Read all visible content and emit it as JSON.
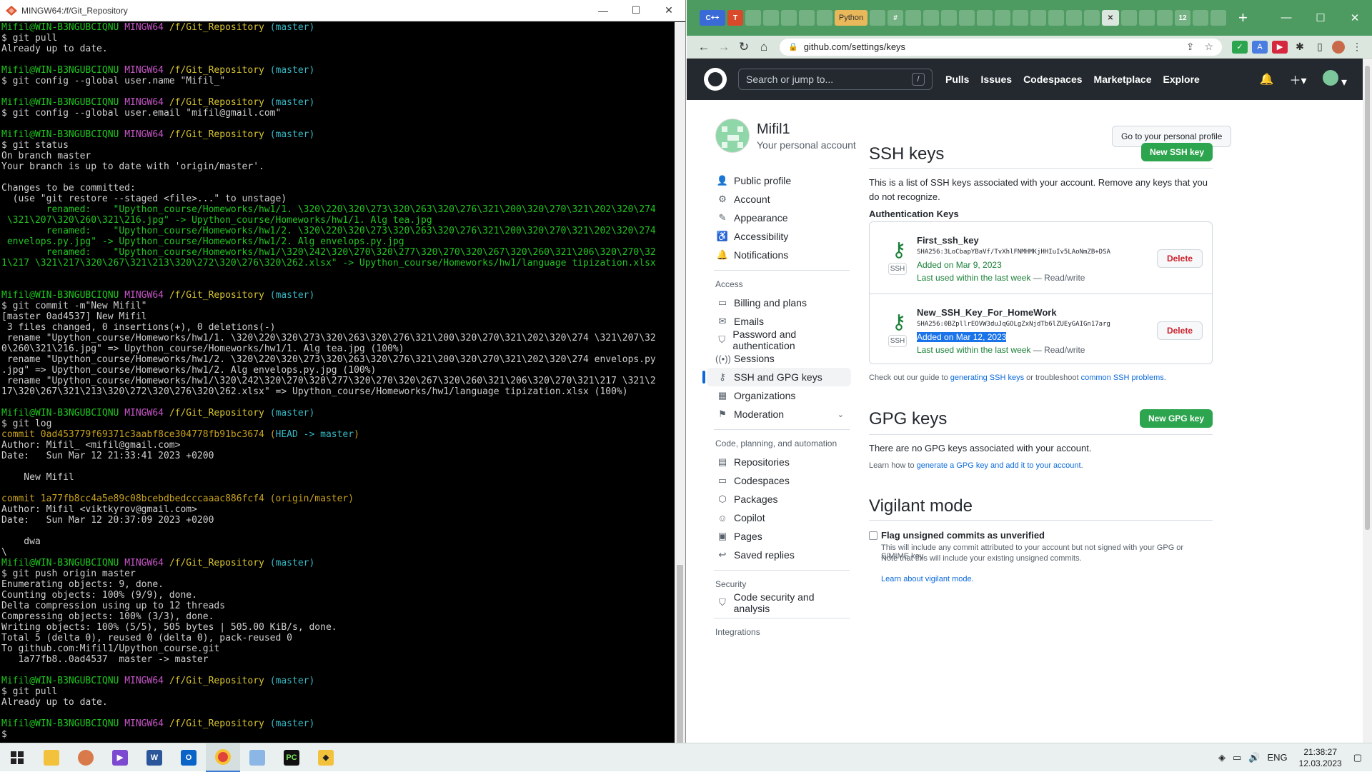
{
  "terminal": {
    "title": "MINGW64:/f/Git_Repository",
    "lines": [
      [
        [
          "p",
          "Mifil@WIN-B3NGUBCIQNU "
        ],
        [
          "h",
          "MINGW64 "
        ],
        [
          "d",
          "/f/Git_Repository "
        ],
        [
          "b",
          "(master)"
        ]
      ],
      [
        [
          "n",
          "$ git pull"
        ]
      ],
      [
        [
          "n",
          "Already up to date."
        ]
      ],
      [
        [
          "n",
          ""
        ]
      ],
      [
        [
          "p",
          "Mifil@WIN-B3NGUBCIQNU "
        ],
        [
          "h",
          "MINGW64 "
        ],
        [
          "d",
          "/f/Git_Repository "
        ],
        [
          "b",
          "(master)"
        ]
      ],
      [
        [
          "n",
          "$ git config --global user.name \"Mifil_\""
        ]
      ],
      [
        [
          "n",
          ""
        ]
      ],
      [
        [
          "p",
          "Mifil@WIN-B3NGUBCIQNU "
        ],
        [
          "h",
          "MINGW64 "
        ],
        [
          "d",
          "/f/Git_Repository "
        ],
        [
          "b",
          "(master)"
        ]
      ],
      [
        [
          "n",
          "$ git config --global user.email \"mifil@gmail.com\""
        ]
      ],
      [
        [
          "n",
          ""
        ]
      ],
      [
        [
          "p",
          "Mifil@WIN-B3NGUBCIQNU "
        ],
        [
          "h",
          "MINGW64 "
        ],
        [
          "d",
          "/f/Git_Repository "
        ],
        [
          "b",
          "(master)"
        ]
      ],
      [
        [
          "n",
          "$ git status"
        ]
      ],
      [
        [
          "n",
          "On branch master"
        ]
      ],
      [
        [
          "n",
          "Your branch is up to date with 'origin/master'."
        ]
      ],
      [
        [
          "n",
          ""
        ]
      ],
      [
        [
          "n",
          "Changes to be committed:"
        ]
      ],
      [
        [
          "n",
          "  (use \"git restore --staged <file>...\" to unstage)"
        ]
      ],
      [
        [
          "g",
          "        renamed:    \"Upython_course/Homeworks/hw1/1. \\320\\220\\320\\273\\320\\263\\320\\276\\321\\200\\320\\270\\321\\202\\320\\274"
        ]
      ],
      [
        [
          "g",
          " \\321\\207\\320\\260\\321\\216.jpg\" -> Upython_course/Homeworks/hw1/1. Alg tea.jpg"
        ]
      ],
      [
        [
          "g",
          "        renamed:    \"Upython_course/Homeworks/hw1/2. \\320\\220\\320\\273\\320\\263\\320\\276\\321\\200\\320\\270\\321\\202\\320\\274"
        ]
      ],
      [
        [
          "g",
          " envelops.py.jpg\" -> Upython_course/Homeworks/hw1/2. Alg envelops.py.jpg"
        ]
      ],
      [
        [
          "g",
          "        renamed:    \"Upython_course/Homeworks/hw1/\\320\\242\\320\\270\\320\\277\\320\\270\\320\\267\\320\\260\\321\\206\\320\\270\\32"
        ]
      ],
      [
        [
          "g",
          "1\\217 \\321\\217\\320\\267\\321\\213\\320\\272\\320\\276\\320\\262.xlsx\" -> Upython_course/Homeworks/hw1/language tipization.xlsx"
        ]
      ],
      [
        [
          "n",
          ""
        ]
      ],
      [
        [
          "n",
          ""
        ]
      ],
      [
        [
          "p",
          "Mifil@WIN-B3NGUBCIQNU "
        ],
        [
          "h",
          "MINGW64 "
        ],
        [
          "d",
          "/f/Git_Repository "
        ],
        [
          "b",
          "(master)"
        ]
      ],
      [
        [
          "n",
          "$ git commit -m\"New Mifil\""
        ]
      ],
      [
        [
          "n",
          "[master 0ad4537] New Mifil"
        ]
      ],
      [
        [
          "n",
          " 3 files changed, 0 insertions(+), 0 deletions(-)"
        ]
      ],
      [
        [
          "n",
          " rename \"Upython_course/Homeworks/hw1/1. \\320\\220\\320\\273\\320\\263\\320\\276\\321\\200\\320\\270\\321\\202\\320\\274 \\321\\207\\32"
        ]
      ],
      [
        [
          "n",
          "0\\260\\321\\216.jpg\" => Upython_course/Homeworks/hw1/1. Alg tea.jpg (100%)"
        ]
      ],
      [
        [
          "n",
          " rename \"Upython_course/Homeworks/hw1/2. \\320\\220\\320\\273\\320\\263\\320\\276\\321\\200\\320\\270\\321\\202\\320\\274 envelops.py"
        ]
      ],
      [
        [
          "n",
          ".jpg\" => Upython_course/Homeworks/hw1/2. Alg envelops.py.jpg (100%)"
        ]
      ],
      [
        [
          "n",
          " rename \"Upython_course/Homeworks/hw1/\\320\\242\\320\\270\\320\\277\\320\\270\\320\\267\\320\\260\\321\\206\\320\\270\\321\\217 \\321\\2"
        ]
      ],
      [
        [
          "n",
          "17\\320\\267\\321\\213\\320\\272\\320\\276\\320\\262.xlsx\" => Upython_course/Homeworks/hw1/language tipization.xlsx (100%)"
        ]
      ],
      [
        [
          "n",
          ""
        ]
      ],
      [
        [
          "p",
          "Mifil@WIN-B3NGUBCIQNU "
        ],
        [
          "h",
          "MINGW64 "
        ],
        [
          "d",
          "/f/Git_Repository "
        ],
        [
          "b",
          "(master)"
        ]
      ],
      [
        [
          "n",
          "$ git log"
        ]
      ],
      [
        [
          "y",
          "commit 0ad453779f69371c3aabf8ce304778fb91bc3674 "
        ],
        [
          "y",
          "("
        ],
        [
          "c",
          "HEAD -> master"
        ],
        [
          "y",
          ")"
        ]
      ],
      [
        [
          "n",
          "Author: Mifil_ <mifil@gmail.com>"
        ]
      ],
      [
        [
          "n",
          "Date:   Sun Mar 12 21:33:41 2023 +0200"
        ]
      ],
      [
        [
          "n",
          ""
        ]
      ],
      [
        [
          "n",
          "    New Mifil"
        ]
      ],
      [
        [
          "n",
          ""
        ]
      ],
      [
        [
          "y",
          "commit 1a77fb8cc4a5e89c08bcebdbedcccaaac886fcf4 (origin/master)"
        ]
      ],
      [
        [
          "n",
          "Author: Mifil <viktkyrov@gmail.com>"
        ]
      ],
      [
        [
          "n",
          "Date:   Sun Mar 12 20:37:09 2023 +0200"
        ]
      ],
      [
        [
          "n",
          ""
        ]
      ],
      [
        [
          "n",
          "    dwa"
        ]
      ],
      [
        [
          "n",
          "\\"
        ]
      ],
      [
        [
          "p",
          "Mifil@WIN-B3NGUBCIQNU "
        ],
        [
          "h",
          "MINGW64 "
        ],
        [
          "d",
          "/f/Git_Repository "
        ],
        [
          "b",
          "(master)"
        ]
      ],
      [
        [
          "n",
          "$ git push origin master"
        ]
      ],
      [
        [
          "n",
          "Enumerating objects: 9, done."
        ]
      ],
      [
        [
          "n",
          "Counting objects: 100% (9/9), done."
        ]
      ],
      [
        [
          "n",
          "Delta compression using up to 12 threads"
        ]
      ],
      [
        [
          "n",
          "Compressing objects: 100% (3/3), done."
        ]
      ],
      [
        [
          "n",
          "Writing objects: 100% (5/5), 505 bytes | 505.00 KiB/s, done."
        ]
      ],
      [
        [
          "n",
          "Total 5 (delta 0), reused 0 (delta 0), pack-reused 0"
        ]
      ],
      [
        [
          "n",
          "To github.com:Mifil1/Upython_course.git"
        ]
      ],
      [
        [
          "n",
          "   1a77fb8..0ad4537  master -> master"
        ]
      ],
      [
        [
          "n",
          ""
        ]
      ],
      [
        [
          "p",
          "Mifil@WIN-B3NGUBCIQNU "
        ],
        [
          "h",
          "MINGW64 "
        ],
        [
          "d",
          "/f/Git_Repository "
        ],
        [
          "b",
          "(master)"
        ]
      ],
      [
        [
          "n",
          "$ git pull"
        ]
      ],
      [
        [
          "n",
          "Already up to date."
        ]
      ],
      [
        [
          "n",
          ""
        ]
      ],
      [
        [
          "p",
          "Mifil@WIN-B3NGUBCIQNU "
        ],
        [
          "h",
          "MINGW64 "
        ],
        [
          "d",
          "/f/Git_Repository "
        ],
        [
          "b",
          "(master)"
        ]
      ],
      [
        [
          "n",
          "$ "
        ]
      ]
    ]
  },
  "browser": {
    "tabs": [
      "C++",
      "T",
      "",
      "",
      "",
      "",
      "",
      "Python",
      "",
      "#",
      "",
      "",
      "",
      "",
      "",
      "",
      "",
      "",
      "",
      "",
      "",
      "",
      "",
      "",
      "12",
      "",
      ""
    ],
    "active_tab_close": "✕",
    "new_tab": "+",
    "url": "github.com/settings/keys"
  },
  "header": {
    "search_placeholder": "Search or jump to...",
    "search_shortcut": "/",
    "nav": [
      "Pulls",
      "Issues",
      "Codespaces",
      "Marketplace",
      "Explore"
    ]
  },
  "profile": {
    "name": "Mifil1",
    "subtitle": "Your personal account",
    "goto_button": "Go to your personal profile"
  },
  "sidebar": {
    "top_items": [
      {
        "icon": "person-icon",
        "glyph": "👤",
        "label": "Public profile"
      },
      {
        "icon": "gear-icon",
        "glyph": "⚙",
        "label": "Account"
      },
      {
        "icon": "paintbrush-icon",
        "glyph": "✎",
        "label": "Appearance"
      },
      {
        "icon": "accessibility-icon",
        "glyph": "♿",
        "label": "Accessibility"
      },
      {
        "icon": "bell-icon",
        "glyph": "🔔",
        "label": "Notifications"
      }
    ],
    "access_label": "Access",
    "access_items": [
      {
        "icon": "credit-card-icon",
        "glyph": "▭",
        "label": "Billing and plans"
      },
      {
        "icon": "mail-icon",
        "glyph": "✉",
        "label": "Emails"
      },
      {
        "icon": "shield-lock-icon",
        "glyph": "⛉",
        "label": "Password and authentication"
      },
      {
        "icon": "broadcast-icon",
        "glyph": "((•))",
        "label": "Sessions"
      },
      {
        "icon": "key-icon",
        "glyph": "⚷",
        "label": "SSH and GPG keys"
      },
      {
        "icon": "organization-icon",
        "glyph": "▦",
        "label": "Organizations"
      },
      {
        "icon": "report-icon",
        "glyph": "⚑",
        "label": "Moderation"
      }
    ],
    "code_label": "Code, planning, and automation",
    "code_items": [
      {
        "icon": "repo-icon",
        "glyph": "▤",
        "label": "Repositories"
      },
      {
        "icon": "codespaces-icon",
        "glyph": "▭",
        "label": "Codespaces"
      },
      {
        "icon": "package-icon",
        "glyph": "⬡",
        "label": "Packages"
      },
      {
        "icon": "copilot-icon",
        "glyph": "☺",
        "label": "Copilot"
      },
      {
        "icon": "browser-icon",
        "glyph": "▣",
        "label": "Pages"
      },
      {
        "icon": "reply-icon",
        "glyph": "↩",
        "label": "Saved replies"
      }
    ],
    "security_label": "Security",
    "security_items": [
      {
        "icon": "shield-icon",
        "glyph": "⛉",
        "label": "Code security and analysis"
      }
    ],
    "integrations_label": "Integrations"
  },
  "ssh": {
    "title": "SSH keys",
    "new_button": "New SSH key",
    "description": "This is a list of SSH keys associated with your account. Remove any keys that you do not recognize.",
    "auth_label": "Authentication Keys",
    "keys": [
      {
        "title": "First_ssh_key",
        "fingerprint": "SHA256:3LoCbapYBaVf/TvXhlFNMHMKjHHIuIv5LAoNmZB+DSA",
        "added": "Added on Mar 9, 2023",
        "last_used": "Last used within the last week",
        "access": " — Read/write",
        "badge": "SSH",
        "delete": "Delete",
        "selected": false
      },
      {
        "title": "New_SSH_Key_For_HomeWork",
        "fingerprint": "SHA256:0BZpllrEOVW3duJqGOLgZxNjdTb6lZUEyGAIGn17arg",
        "added": "Added on Mar 12, 2023",
        "last_used": "Last used within the last week",
        "access": " — Read/write",
        "badge": "SSH",
        "delete": "Delete",
        "selected": true
      }
    ],
    "guide_prefix": "Check out our guide to ",
    "guide_link1": "generating SSH keys",
    "guide_middle": " or troubleshoot ",
    "guide_link2": "common SSH problems",
    "guide_suffix": "."
  },
  "gpg": {
    "title": "GPG keys",
    "new_button": "New GPG key",
    "none_text": "There are no GPG keys associated with your account.",
    "learn_prefix": "Learn how to ",
    "learn_link": "generate a GPG key and add it to your account",
    "learn_suffix": "."
  },
  "vigilant": {
    "title": "Vigilant mode",
    "checkbox_label": "Flag unsigned commits as unverified",
    "desc1": "This will include any commit attributed to your account but not signed with your GPG or S/MIME key.",
    "desc2": "Note that this will include your existing unsigned commits.",
    "learn_link": "Learn about vigilant mode."
  },
  "taskbar": {
    "lang": "ENG",
    "time": "21:38:27",
    "date": "12.03.2023",
    "pc_label": "PC"
  },
  "colors": {
    "gh_header": "#24292f",
    "gh_green": "#2da44e",
    "link_blue": "#0969da",
    "tab_strip": "#4d9b61"
  }
}
